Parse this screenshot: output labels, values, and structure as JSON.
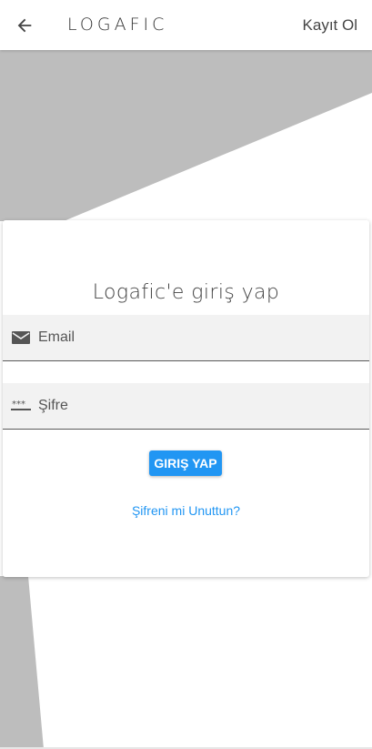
{
  "appbar": {
    "back_icon": "arrow-left-icon",
    "brand": "LOGAFIC",
    "register_label": "Kayıt Ol"
  },
  "login_card": {
    "title": "Logafic'e giriş yap",
    "email": {
      "icon": "envelope-icon",
      "placeholder": "Email",
      "value": ""
    },
    "password": {
      "icon": "password-dots-icon",
      "placeholder": "Şifre",
      "value": ""
    },
    "submit_label": "GIRIŞ YAP",
    "forgot_label": "Şifreni mi Unuttun?"
  },
  "colors": {
    "accent": "#2196f3",
    "background_shape": "#bdbdbd",
    "field_background": "#f2f2f2"
  }
}
